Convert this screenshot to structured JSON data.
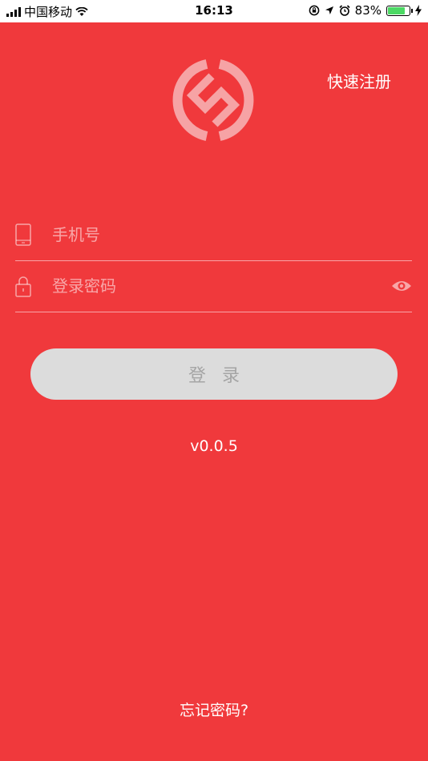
{
  "status_bar": {
    "carrier": "中国移动",
    "time": "16:13",
    "battery_percent": "83%",
    "battery_level": 0.83,
    "icons": [
      "signal-icon",
      "wifi-icon",
      "rotation-lock-icon",
      "location-icon",
      "alarm-icon",
      "battery-icon",
      "charging-icon"
    ]
  },
  "header": {
    "register_label": "快速注册",
    "logo_icon": "brand-logo-icon"
  },
  "form": {
    "phone": {
      "placeholder": "手机号",
      "value": "",
      "icon": "phone-icon"
    },
    "password": {
      "placeholder": "登录密码",
      "value": "",
      "icon": "lock-icon",
      "toggle_icon": "eye-icon"
    },
    "login_label": "登录"
  },
  "footer": {
    "version": "v0.0.5",
    "forgot_label": "忘记密码?"
  },
  "colors": {
    "background": "#f0393c",
    "button_bg": "#dcdcdc",
    "button_text": "#a5a5a5",
    "logo": "#f6a3a5"
  }
}
